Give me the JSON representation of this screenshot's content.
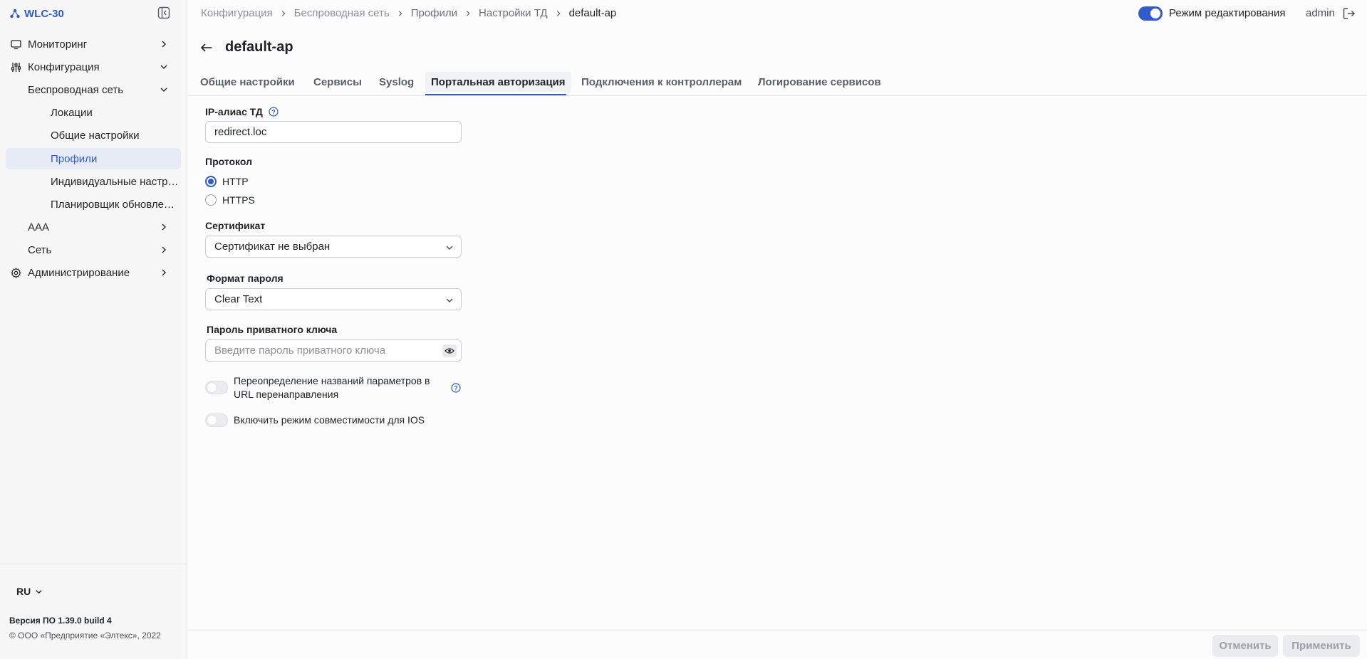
{
  "app": {
    "name": "WLC-30"
  },
  "sidebar": {
    "items": [
      {
        "label": "Мониторинг",
        "icon": "monitor-icon"
      },
      {
        "label": "Конфигурация",
        "icon": "config-sliders-icon"
      },
      {
        "label": "Беспроводная сеть"
      },
      {
        "label": "Локации"
      },
      {
        "label": "Общие настройки"
      },
      {
        "label": "Профили"
      },
      {
        "label": "Индивидуальные настройки ТД"
      },
      {
        "label": "Планировщик обновлений"
      },
      {
        "label": "AAA"
      },
      {
        "label": "Сеть"
      },
      {
        "label": "Администрирование",
        "icon": "gear-icon"
      }
    ],
    "language": "RU",
    "version": "Версия ПО 1.39.0 build 4",
    "copyright": "© ООО «Предприятие «Элтекс», 2022"
  },
  "header": {
    "breadcrumb": [
      "Конфигурация",
      "Беспроводная сеть",
      "Профили",
      "Настройки ТД",
      "default-ap"
    ],
    "edit_mode_label": "Режим редактирования",
    "user": "admin"
  },
  "page": {
    "title": "default-ap",
    "tabs": [
      "Общие настройки",
      "Сервисы",
      "Syslog",
      "Портальная авторизация",
      "Подключения к контроллерам",
      "Логирование сервисов"
    ]
  },
  "form": {
    "ip_alias_label": "IP-алиас ТД",
    "ip_alias_value": "redirect.loc",
    "protocol_label": "Протокол",
    "protocol_options": [
      "HTTP",
      "HTTPS"
    ],
    "certificate_label": "Сертификат",
    "certificate_value": "Сертификат не выбран",
    "password_format_label": "Формат пароля",
    "password_format_value": "Clear Text",
    "private_key_label": "Пароль приватного ключа",
    "private_key_placeholder": "Введите пароль приватного ключа",
    "override_label_line1": "Переопределение названий параметров в",
    "override_label_line2": "URL перенаправления",
    "ios_compat_label": "Включить режим совместимости для IOS"
  },
  "footer": {
    "cancel_label": "Отменить",
    "apply_label": "Применить"
  },
  "colors": {
    "accent": "#2f5cc8"
  }
}
